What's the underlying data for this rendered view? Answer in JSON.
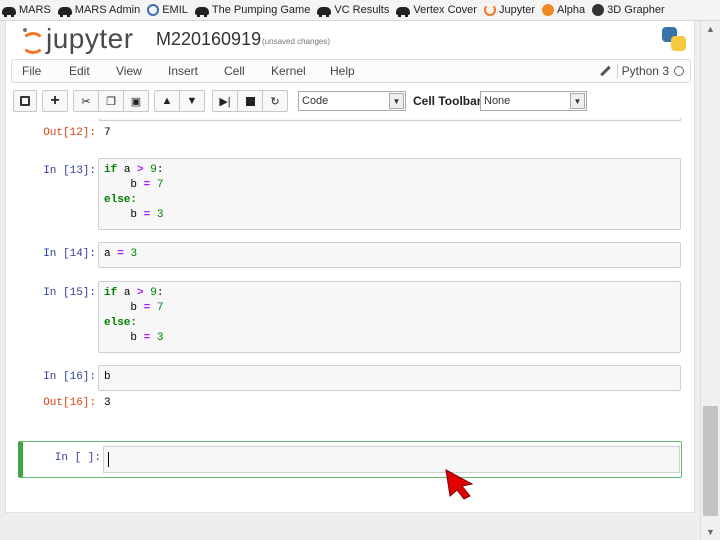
{
  "bookmarks": [
    {
      "label": "MARS",
      "icon": "car-icon"
    },
    {
      "label": "MARS Admin",
      "icon": "car-icon"
    },
    {
      "label": "EMIL",
      "icon": "emil-icon"
    },
    {
      "label": "The Pumping Game",
      "icon": "car-icon"
    },
    {
      "label": "VC Results",
      "icon": "car-icon"
    },
    {
      "label": "Vertex Cover",
      "icon": "car-icon"
    },
    {
      "label": "Jupyter",
      "icon": "jupyter-icon"
    },
    {
      "label": "Alpha",
      "icon": "alpha-icon"
    },
    {
      "label": "3D Grapher",
      "icon": "grapher-icon"
    }
  ],
  "header": {
    "logo_text": "jupyter",
    "notebook_name": "M220160919",
    "save_status": "(unsaved changes)"
  },
  "menu": {
    "items": [
      "File",
      "Edit",
      "View",
      "Insert",
      "Cell",
      "Kernel",
      "Help"
    ],
    "kernel_name": "Python 3"
  },
  "toolbar": {
    "icons": [
      "save-icon",
      "add-cell-icon",
      "cut-icon",
      "copy-icon",
      "paste-icon",
      "move-up-icon",
      "move-down-icon",
      "run-icon",
      "stop-icon",
      "restart-icon"
    ],
    "cell_type": "Code",
    "cell_toolbar_label": "Cell Toolbar:",
    "cell_toolbar_value": "None"
  },
  "cells": {
    "out12": {
      "prompt": "Out[12]:",
      "text": "7"
    },
    "in13": {
      "prompt": "In [13]:"
    },
    "in14": {
      "prompt": "In [14]:"
    },
    "in15": {
      "prompt": "In [15]:"
    },
    "in16": {
      "prompt": "In [16]:",
      "code": "b"
    },
    "out16": {
      "prompt": "Out[16]:",
      "text": "3"
    },
    "active": {
      "prompt": "In [ ]:"
    }
  },
  "code_tokens": {
    "if": "if",
    "else": "else:",
    "a": "a",
    "b": "b",
    "gt": ">",
    "eq": "=",
    "nine": "9",
    "seven": "7",
    "three": "3",
    "colon": ":"
  },
  "colors": {
    "active_border": "#42a545",
    "prompt_in": "#303f9f",
    "prompt_out": "#d84315",
    "keyword": "#008000",
    "cursor": "#e00000"
  }
}
